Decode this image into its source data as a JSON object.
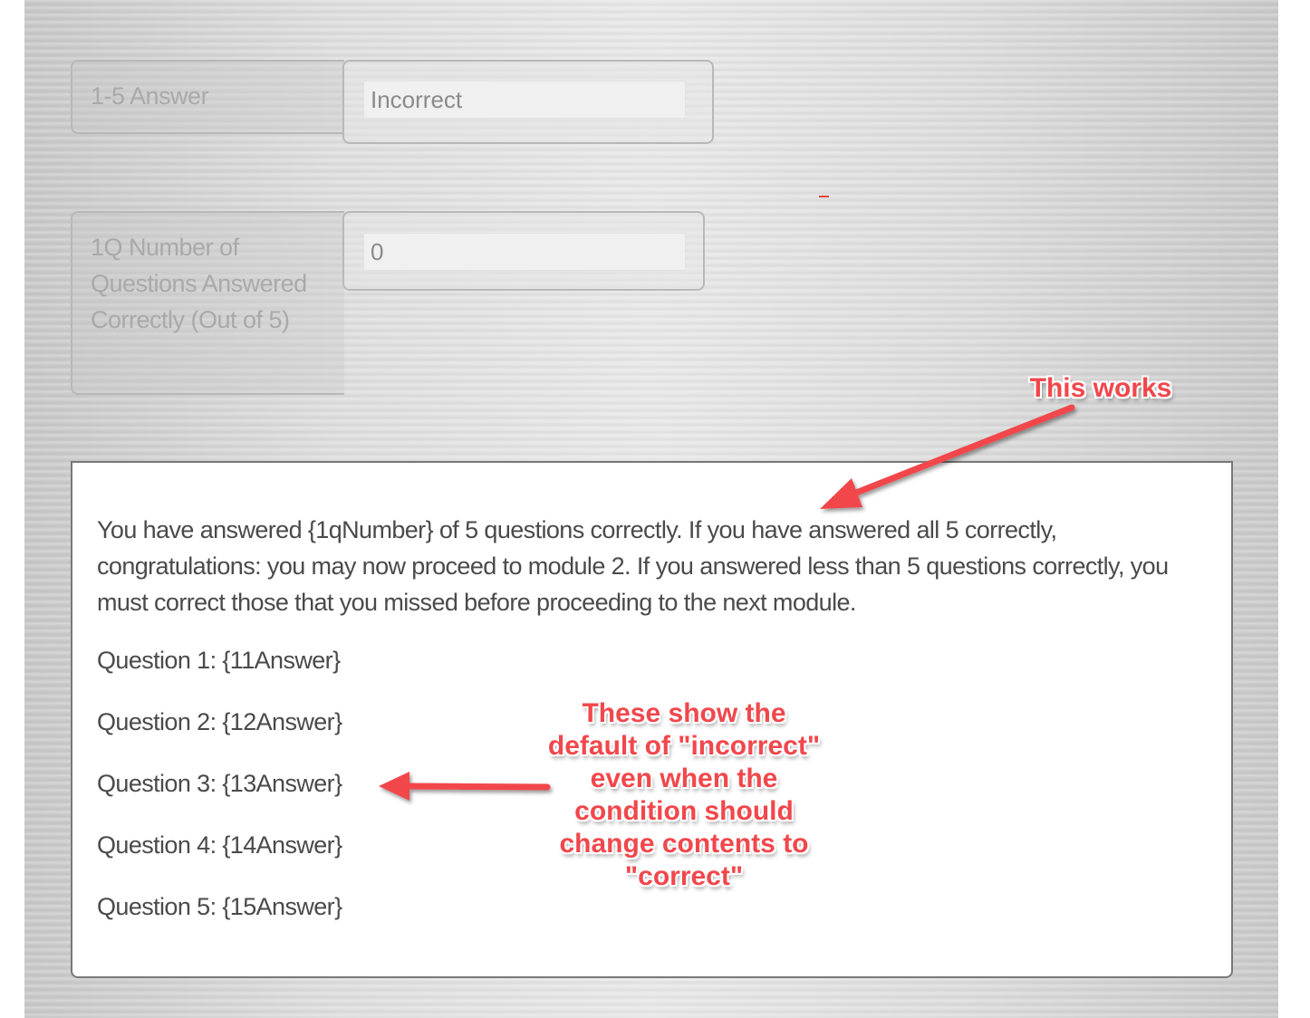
{
  "fields": [
    {
      "label": "1-5 Answer",
      "value": "Incorrect"
    },
    {
      "label": "1Q Number of Questions Answered Correctly (Out of 5)",
      "value": "0"
    }
  ],
  "panel": {
    "paragraph": "You have answered {1qNumber} of 5 questions correctly.  If you have answered all 5 correctly, congratulations:  you may now proceed to module 2.  If you answered less than 5 questions correctly, you must correct those that you missed before proceeding to the next module.",
    "questions": [
      "Question 1:  {11Answer}",
      "Question 2:  {12Answer}",
      "Question 3:  {13Answer}",
      "Question 4:  {14Answer}",
      "Question 5:  {15Answer}"
    ]
  },
  "annotations": {
    "top": "This works",
    "middle": "These show the default of \"incorrect\" even when the condition should change contents to \"correct\"",
    "color": "#f1474c"
  }
}
